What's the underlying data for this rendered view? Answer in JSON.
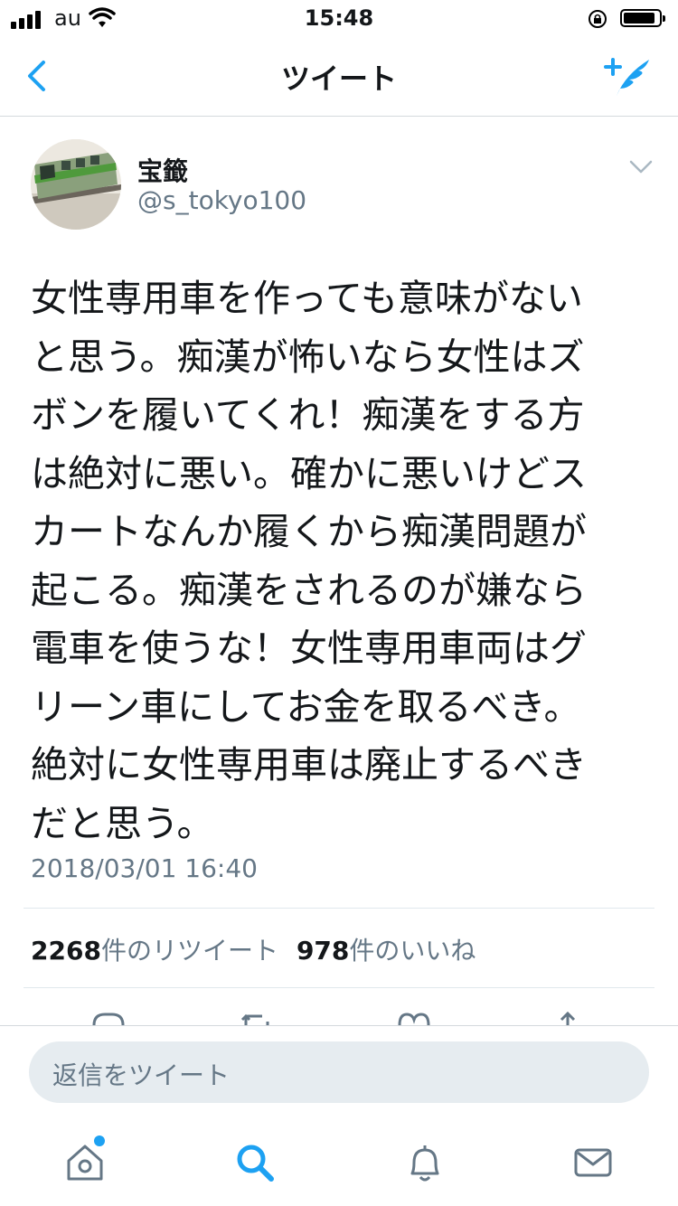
{
  "status_bar": {
    "carrier": "au",
    "time": "15:48"
  },
  "nav": {
    "title": "ツイート"
  },
  "tweet": {
    "display_name": "宝籤",
    "handle": "@s_tokyo100",
    "text": "女性専用車を作っても意味がない\nと思う。痴漢が怖いなら女性はズ\nボンを履いてくれ！痴漢をする方\nは絶対に悪い。確かに悪いけどス\nカートなんか履くから痴漢問題が\n起こる。痴漢をされるのが嫌なら\n電車を使うな！女性専用車両はグ\nリーン車にしてお金を取るべき。\n絶対に女性専用車は廃止するべき\nだと思う。",
    "timestamp": "2018/03/01 16:40",
    "retweet_count": "2268",
    "retweet_label": "件のリツイート",
    "like_count": "978",
    "like_label": "件のいいね"
  },
  "reply_bar": {
    "placeholder": "返信をツイート"
  },
  "colors": {
    "accent": "#1da1f2",
    "secondary_text": "#657786",
    "primary_text": "#14171a"
  },
  "tab_bar": {
    "items": [
      "home-icon",
      "search-icon",
      "notifications-icon",
      "messages-icon"
    ],
    "active": "search-icon",
    "home_unread": true
  }
}
